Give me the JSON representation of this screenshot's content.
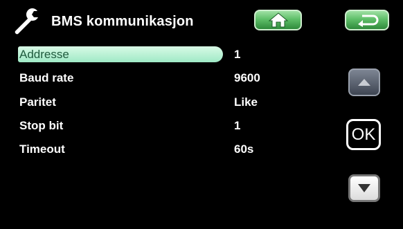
{
  "header": {
    "title": "BMS kommunikasjon",
    "icons": {
      "left": "wrench-icon",
      "home": "home-icon",
      "back": "return-arrow-icon"
    }
  },
  "settings": [
    {
      "label": "Addresse",
      "value": "1",
      "selected": true
    },
    {
      "label": "Baud rate",
      "value": "9600",
      "selected": false
    },
    {
      "label": "Paritet",
      "value": "Like",
      "selected": false
    },
    {
      "label": "Stop bit",
      "value": "1",
      "selected": false
    },
    {
      "label": "Timeout",
      "value": "60s",
      "selected": false
    }
  ],
  "controls": {
    "ok_label": "OK",
    "up_icon": "up-arrow-icon",
    "down_icon": "down-arrow-icon"
  },
  "colors": {
    "background": "#000000",
    "accent_green": "#5fbf69",
    "selection": "#b8f1d5"
  }
}
